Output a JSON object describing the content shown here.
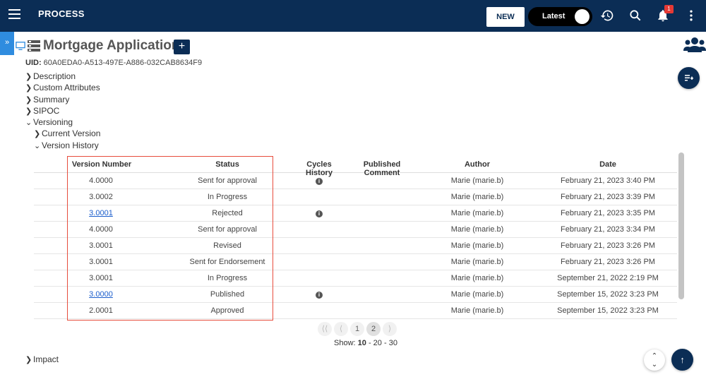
{
  "app": {
    "title": "PROCESS"
  },
  "toolbar": {
    "new_label": "NEW",
    "toggle_label": "Latest",
    "notification_count": "1"
  },
  "page": {
    "title": "Mortgage Application",
    "uid_label": "UID:",
    "uid_value": "60A0EDA0-A513-497E-A886-032CAB8634F9",
    "left_tab": "»",
    "add_symbol": "+"
  },
  "tree": {
    "description": "Description",
    "custom_attributes": "Custom Attributes",
    "summary": "Summary",
    "sipoc": "SIPOC",
    "versioning": "Versioning",
    "current_version": "Current Version",
    "version_history": "Version History",
    "impact": "Impact"
  },
  "table": {
    "headers": {
      "version_number": "Version Number",
      "status": "Status",
      "cycles_history": "Cycles History",
      "published_comment": "Published Comment",
      "author": "Author",
      "date": "Date"
    },
    "rows": [
      {
        "version": "4.0000",
        "status": "Sent for approval",
        "info": true,
        "link": false,
        "author": "Marie (marie.b)",
        "date": "February 21, 2023 3:40 PM"
      },
      {
        "version": "3.0002",
        "status": "In Progress",
        "info": false,
        "link": false,
        "author": "Marie (marie.b)",
        "date": "February 21, 2023 3:39 PM"
      },
      {
        "version": "3.0001",
        "status": "Rejected",
        "info": true,
        "link": true,
        "author": "Marie (marie.b)",
        "date": "February 21, 2023 3:35 PM"
      },
      {
        "version": "4.0000",
        "status": "Sent for approval",
        "info": false,
        "link": false,
        "author": "Marie (marie.b)",
        "date": "February 21, 2023 3:34 PM"
      },
      {
        "version": "3.0001",
        "status": "Revised",
        "info": false,
        "link": false,
        "author": "Marie (marie.b)",
        "date": "February 21, 2023 3:26 PM"
      },
      {
        "version": "3.0001",
        "status": "Sent for Endorsement",
        "info": false,
        "link": false,
        "author": "Marie (marie.b)",
        "date": "February 21, 2023 3:26 PM"
      },
      {
        "version": "3.0001",
        "status": "In Progress",
        "info": false,
        "link": false,
        "author": "Marie (marie.b)",
        "date": "September 21, 2022 2:19 PM"
      },
      {
        "version": "3.0000",
        "status": "Published",
        "info": true,
        "link": true,
        "author": "Marie (marie.b)",
        "date": "September 15, 2022 3:23 PM"
      },
      {
        "version": "2.0001",
        "status": "Approved",
        "info": false,
        "link": false,
        "author": "Marie (marie.b)",
        "date": "September 15, 2022 3:23 PM"
      }
    ]
  },
  "pagination": {
    "first": "⟨⟨",
    "prev": "⟨",
    "pages": [
      "1",
      "2"
    ],
    "current": "2",
    "next": "⟩",
    "show_label": "Show:",
    "show_10": "10",
    "show_20": "20",
    "show_30": "30",
    "sep": " - "
  },
  "colors": {
    "navbar": "#0b2d55",
    "highlight": "#e74c3c",
    "left_tab": "#2f8cdf"
  },
  "icons": [
    "hamburger-icon",
    "history-icon",
    "search-icon",
    "bell-icon",
    "more-vert-icon",
    "people-icon",
    "playlist-add-icon",
    "arrow-up-icon",
    "expand-icon",
    "info-icon"
  ]
}
